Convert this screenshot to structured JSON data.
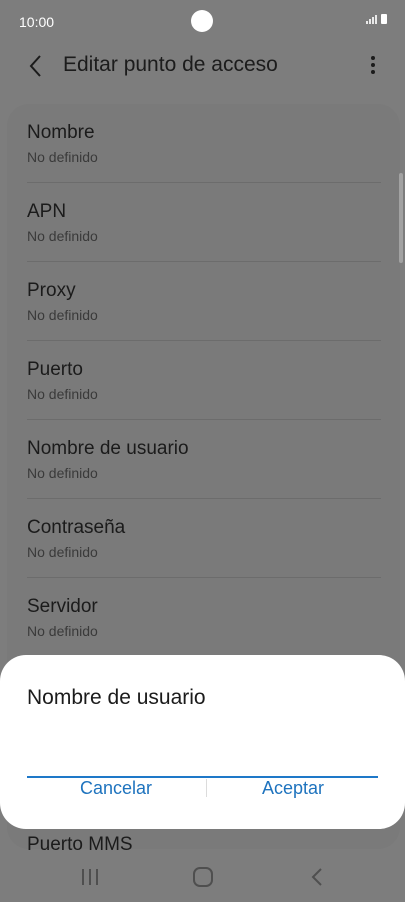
{
  "status_bar": {
    "time": "10:00"
  },
  "app_bar": {
    "title": "Editar punto de acceso"
  },
  "settings": [
    {
      "title": "Nombre",
      "value": "No definido"
    },
    {
      "title": "APN",
      "value": "No definido"
    },
    {
      "title": "Proxy",
      "value": "No definido"
    },
    {
      "title": "Puerto",
      "value": "No definido"
    },
    {
      "title": "Nombre de usuario",
      "value": "No definido"
    },
    {
      "title": "Contraseña",
      "value": "No definido"
    },
    {
      "title": "Servidor",
      "value": "No definido"
    }
  ],
  "partially_visible_item": "Puerto MMS",
  "dialog": {
    "title": "Nombre de usuario",
    "input_value": "",
    "cancel_label": "Cancelar",
    "accept_label": "Aceptar"
  },
  "colors": {
    "accent": "#1e73be",
    "dim_overlay": "#7d7d7d",
    "dialog_bg": "#ffffff"
  },
  "icons": {
    "back": "back-arrow-icon",
    "more": "more-vertical-icon",
    "nav_recents": "recents-icon",
    "nav_home": "home-icon",
    "nav_back": "nav-back-icon"
  }
}
